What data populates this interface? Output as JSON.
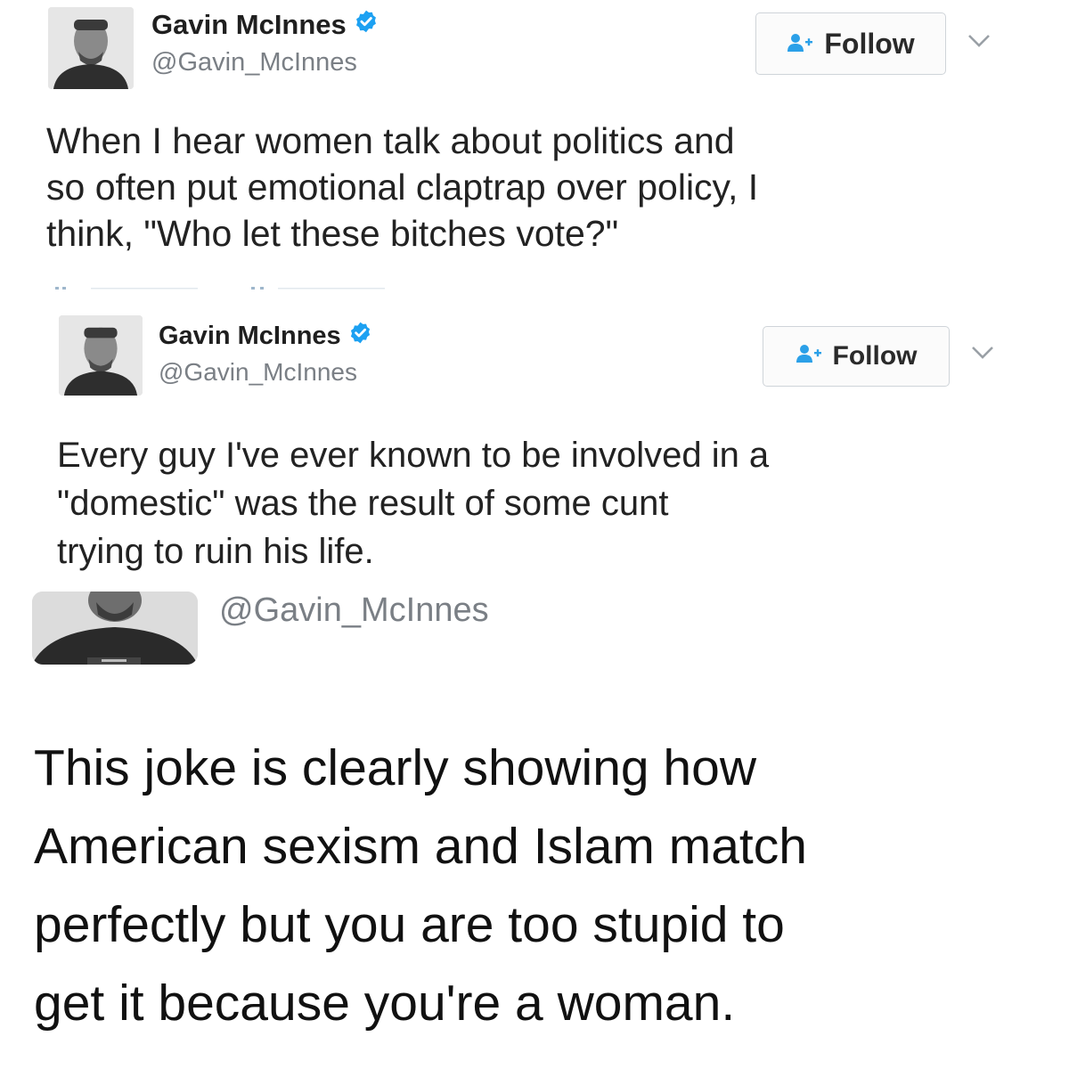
{
  "colors": {
    "verified": "#1da1f2",
    "follow_icon": "#2ba0e8",
    "handle": "#7a7f85",
    "text": "#222222"
  },
  "tweets": [
    {
      "display_name": "Gavin McInnes",
      "handle": "@Gavin_McInnes",
      "follow_label": "Follow",
      "verified_icon": "verified-badge",
      "text_lines": [
        "When I hear women talk about politics and",
        "so often put emotional claptrap over policy, I",
        "think, \"Who let these bitches vote?\""
      ]
    },
    {
      "display_name": "Gavin McInnes",
      "handle": "@Gavin_McInnes",
      "follow_label": "Follow",
      "verified_icon": "verified-badge",
      "text_lines": [
        "Every guy I've ever known to be involved in a",
        "\"domestic\" was the result of some cunt",
        "trying to ruin his life."
      ]
    }
  ],
  "third_handle": "@Gavin_McInnes",
  "caption_lines": [
    "This joke is clearly showing how",
    "American sexism and Islam match",
    "perfectly but you are too stupid to",
    "get it because you're a woman."
  ]
}
